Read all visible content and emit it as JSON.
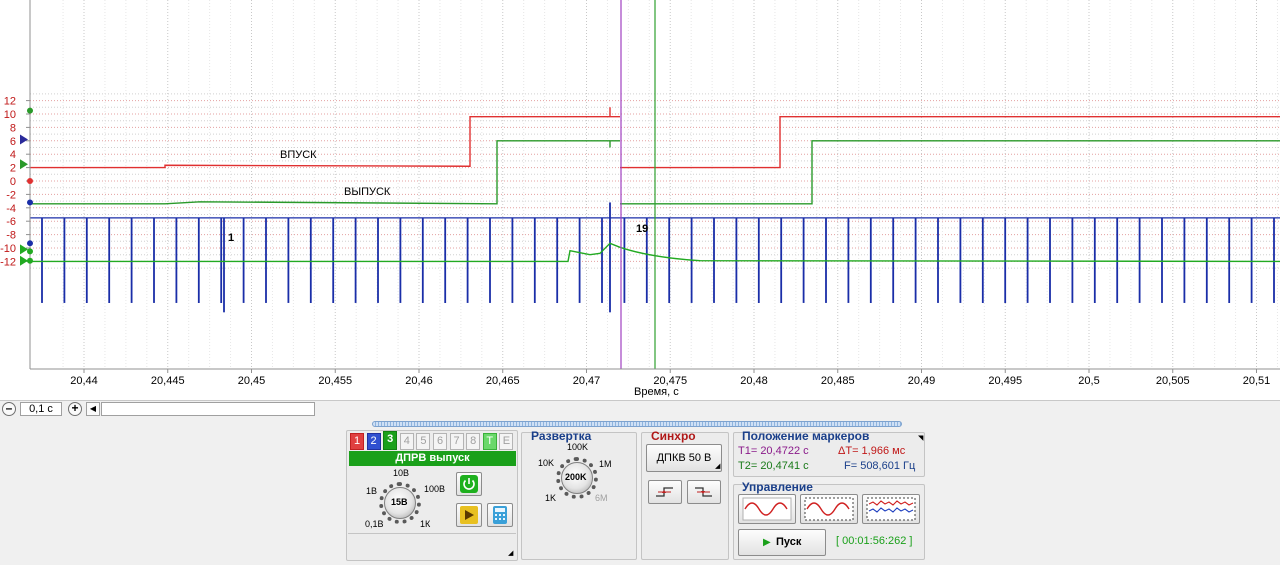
{
  "plot": {
    "y_ticks": [
      "12",
      "10",
      "8",
      "6",
      "4",
      "2",
      "0",
      "-2",
      "-4",
      "-6",
      "-8",
      "-10",
      "-12"
    ],
    "x_ticks": [
      "20,44",
      "20,445",
      "20,45",
      "20,455",
      "20,46",
      "20,465",
      "20,47",
      "20,475",
      "20,48",
      "20,485",
      "20,49",
      "20,495",
      "20,5",
      "20,505",
      "20,51"
    ],
    "x_axis_label": "Время, с",
    "labels": {
      "intake": "ВПУСК",
      "exhaust": "ВЫПУСК",
      "tooth_1": "1",
      "tooth_19": "19"
    },
    "colors": {
      "intake": "#e03030",
      "exhaust": "#2a9a2a",
      "crank": "#1a2ea8",
      "trace4": "#22aa22",
      "marker1": "#a040c0",
      "marker2": "#30a030"
    }
  },
  "zoom": {
    "minus": "⊖",
    "value": "0,1 с",
    "plus": "⊕",
    "left_arrow": "◀"
  },
  "channel_panel": {
    "tabs": [
      "1",
      "2",
      "3",
      "4",
      "5",
      "6",
      "7",
      "8",
      "T",
      "E"
    ],
    "title": "ДПРВ выпуск",
    "knob_labels": [
      "10В",
      "1В",
      "100В",
      "0,1В",
      "1К"
    ],
    "knob_value": "15В"
  },
  "sweep_panel": {
    "title": "Развертка",
    "knob_labels": [
      "100K",
      "10K",
      "1M",
      "1K",
      "6M"
    ],
    "knob_value": "200K"
  },
  "sync_panel": {
    "title": "Синхро",
    "source_button": "ДПКВ 50 В"
  },
  "markers_panel": {
    "title": "Положение маркеров",
    "t1": "T1= 20,4722 с",
    "dt": "ΔT= 1,966 мс",
    "t2": "T2= 20,4741 с",
    "f": "F= 508,601 Гц"
  },
  "control_panel": {
    "title": "Управление",
    "start_button": "Пуск",
    "timer": "[ 00:01:56:262 ]"
  }
}
